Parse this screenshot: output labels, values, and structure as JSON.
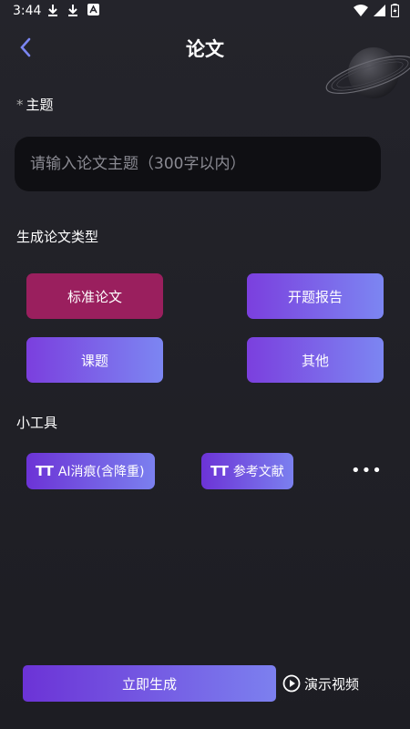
{
  "status_bar": {
    "time": "3:44",
    "notif_icons": [
      "download-icon",
      "download-icon",
      "app-icon"
    ],
    "right_icons": [
      "wifi-icon",
      "signal-icon",
      "battery-icon"
    ]
  },
  "header": {
    "title": "论文"
  },
  "topic": {
    "required_mark": "*",
    "label": "主题",
    "placeholder": "请输入论文主题（300字以内）"
  },
  "paper_type": {
    "label": "生成论文类型",
    "options": [
      "标准论文",
      "开题报告",
      "课题",
      "其他"
    ],
    "selected": "标准论文"
  },
  "tools": {
    "label": "小工具",
    "items": [
      {
        "icon": "text-size-icon",
        "glyph": "TT",
        "label": "AI消痕(含降重)"
      },
      {
        "icon": "text-size-icon",
        "glyph": "TT",
        "label": "参考文献"
      }
    ],
    "more": "•••"
  },
  "footer": {
    "generate_label": "立即生成",
    "demo_label": "演示视频"
  },
  "colors": {
    "selected": "#9a1f5e",
    "gradient_start": "#7b3fde",
    "gradient_end": "#7c86f2",
    "accent_back": "#7b86f2"
  }
}
